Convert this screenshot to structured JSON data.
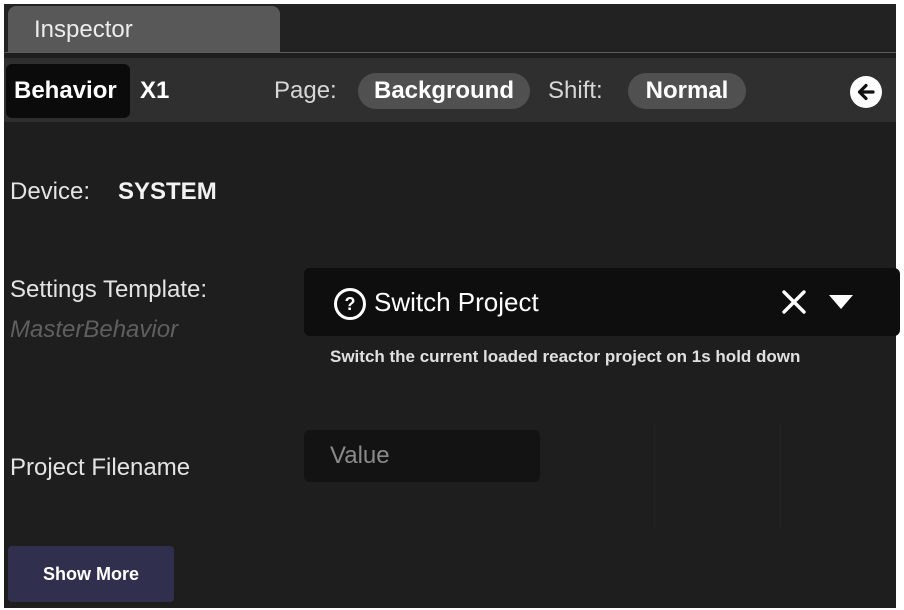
{
  "window": {
    "tab_label": "Inspector"
  },
  "header": {
    "behavior_tab": "Behavior",
    "control_id": "X1",
    "page_label": "Page:",
    "page_value": "Background",
    "shift_label": "Shift:",
    "shift_value": "Normal",
    "back_icon": "arrow-left-circle-icon"
  },
  "device": {
    "label": "Device:",
    "value": "SYSTEM"
  },
  "settings_template": {
    "label": "Settings Template:",
    "source": "MasterBehavior",
    "selected": "Switch Project",
    "help_icon_glyph": "?",
    "description": "Switch the current loaded reactor project on 1s hold down",
    "icons": [
      "help-icon",
      "clear-icon",
      "caret-down-icon"
    ]
  },
  "project_filename": {
    "label": "Project Filename",
    "placeholder": "Value",
    "value": ""
  },
  "footer": {
    "show_more": "Show More"
  },
  "colors": {
    "background": "#1e1e1e",
    "header_bar": "#2f2f2f",
    "pill": "#505050",
    "show_more_button": "#30304e",
    "dropdown": "#0e0e0e"
  }
}
